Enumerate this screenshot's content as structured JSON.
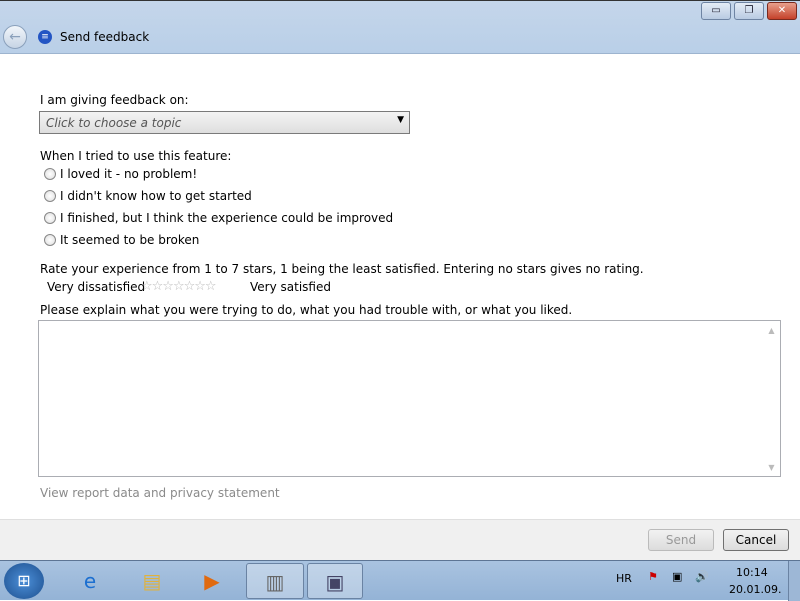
{
  "window": {
    "title": "Send feedback",
    "minimize": "▭",
    "restore": "❐",
    "close": "✕",
    "back": "←"
  },
  "form": {
    "topic_label": "I am giving feedback on:",
    "topic_placeholder": "Click to choose a topic",
    "experience_label": "When I tried to use this feature:",
    "options": [
      "I loved it - no problem!",
      "I didn't know how to get started",
      "I finished, but I think the experience could be improved",
      "It seemed to be broken"
    ],
    "rating_label": "Rate your experience from 1 to 7 stars, 1 being the least satisfied.  Entering no stars gives no rating.",
    "rating_low": "Very dissatisfied",
    "rating_high": "Very satisfied",
    "rating_value": 0,
    "stars": "☆☆☆☆☆☆☆",
    "explain_label": "Please explain what you were trying to do, what you had trouble with, or what you liked.",
    "explain_value": "",
    "privacy_link": "View report data and privacy statement"
  },
  "buttons": {
    "send": "Send",
    "cancel": "Cancel"
  },
  "taskbar": {
    "language": "HR",
    "time": "10:14",
    "date": "20.01.09."
  }
}
